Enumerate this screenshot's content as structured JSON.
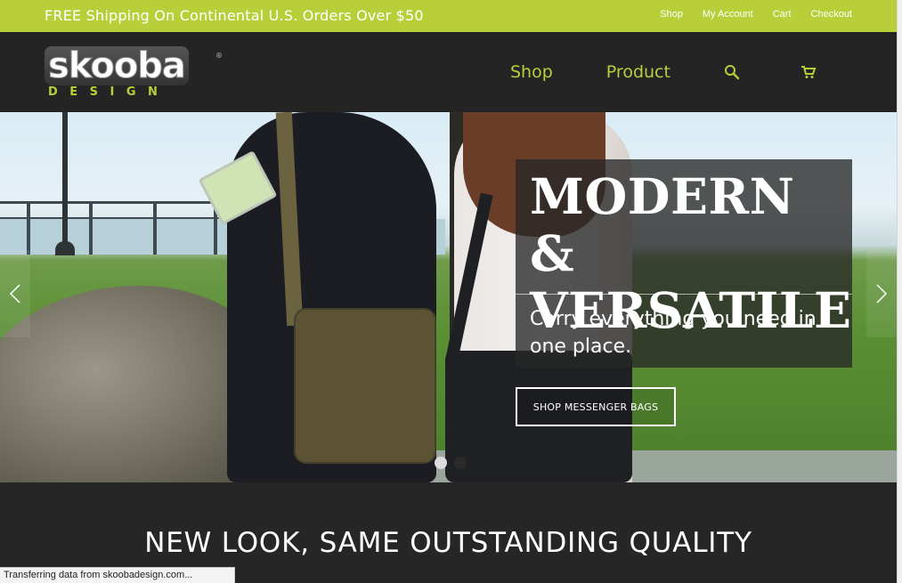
{
  "topbar": {
    "promo": "FREE Shipping On Continental U.S. Orders Over $50",
    "links": [
      "Shop",
      "My Account",
      "Cart",
      "Checkout"
    ]
  },
  "header": {
    "logo_word": "skooba",
    "logo_registered": "®",
    "logo_sub": "DESIGN",
    "nav": {
      "shop": "Shop",
      "product": "Product"
    },
    "icons": [
      "search-icon",
      "cart-icon"
    ]
  },
  "hero": {
    "title_line1": "MODERN &",
    "title_line2": "VERSATILE",
    "subtitle": "Carry everything you need in one place.",
    "cta": "SHOP MESSENGER BAGS",
    "slides_active": 1,
    "slides_total": 2
  },
  "lower": {
    "headline": "NEW LOOK, SAME OUTSTANDING QUALITY"
  },
  "status_bar": {
    "text": "Transferring data from skoobadesign.com..."
  },
  "colors": {
    "brand_green": "#b8cf3a",
    "header_bg": "#242424"
  }
}
